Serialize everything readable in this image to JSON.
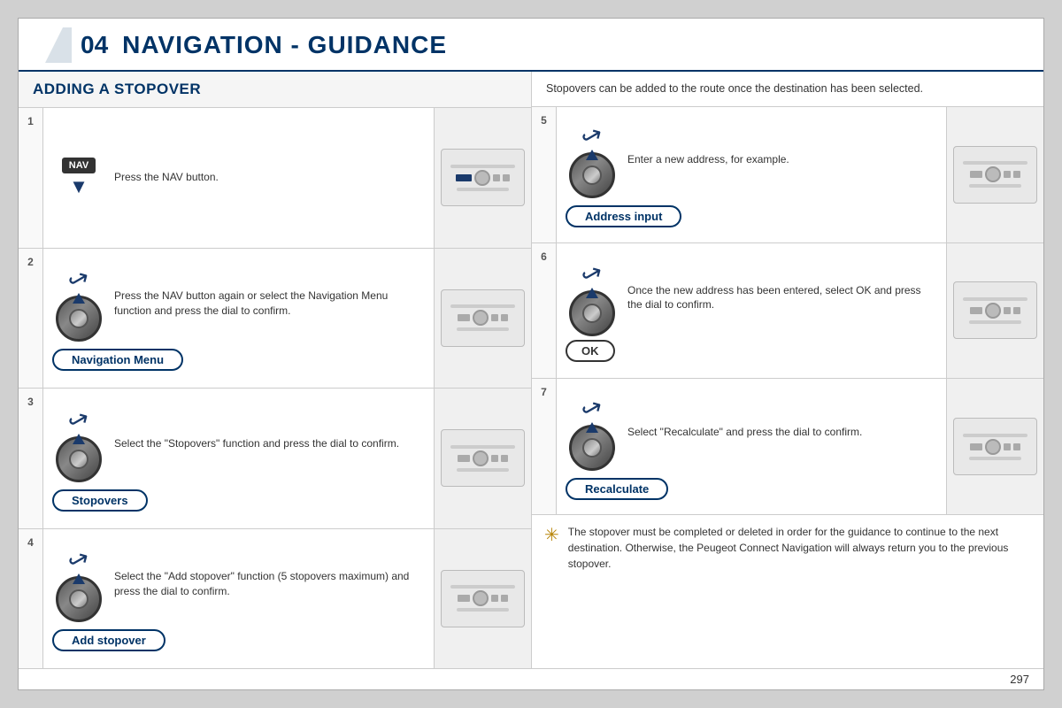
{
  "header": {
    "number": "04",
    "title": "NAVIGATION - GUIDANCE"
  },
  "left_section": {
    "title": "ADDING A STOPOVER"
  },
  "right_section": {
    "description": "Stopovers can be added to the route once the destination has been selected."
  },
  "steps": [
    {
      "number": "1",
      "text": "Press the NAV button.",
      "icon_type": "nav",
      "button": null
    },
    {
      "number": "2",
      "text": "Press the NAV button again or select the Navigation Menu function and press the dial to confirm.",
      "icon_type": "dial",
      "button": "Navigation Menu"
    },
    {
      "number": "3",
      "text": "Select the \"Stopovers\" function and press the dial to confirm.",
      "icon_type": "dial",
      "button": "Stopovers"
    },
    {
      "number": "4",
      "text": "Select the \"Add stopover\" function (5 stopovers maximum) and press the dial to confirm.",
      "icon_type": "dial",
      "button": "Add stopover"
    }
  ],
  "right_steps": [
    {
      "number": "5",
      "text": "Enter a new address, for example.",
      "icon_type": "dial",
      "button": "Address input"
    },
    {
      "number": "6",
      "text": "Once the new address has been entered, select OK and press the dial to confirm.",
      "icon_type": "dial",
      "button": "OK",
      "button_type": "ok"
    },
    {
      "number": "7",
      "text": "Select \"Recalculate\" and press the dial to confirm.",
      "icon_type": "dial",
      "button": "Recalculate"
    }
  ],
  "note": {
    "text": "The stopover must be completed or deleted in order for the guidance to continue to the next destination. Otherwise, the Peugeot Connect Navigation will always return you to the previous stopover."
  },
  "page_number": "297"
}
